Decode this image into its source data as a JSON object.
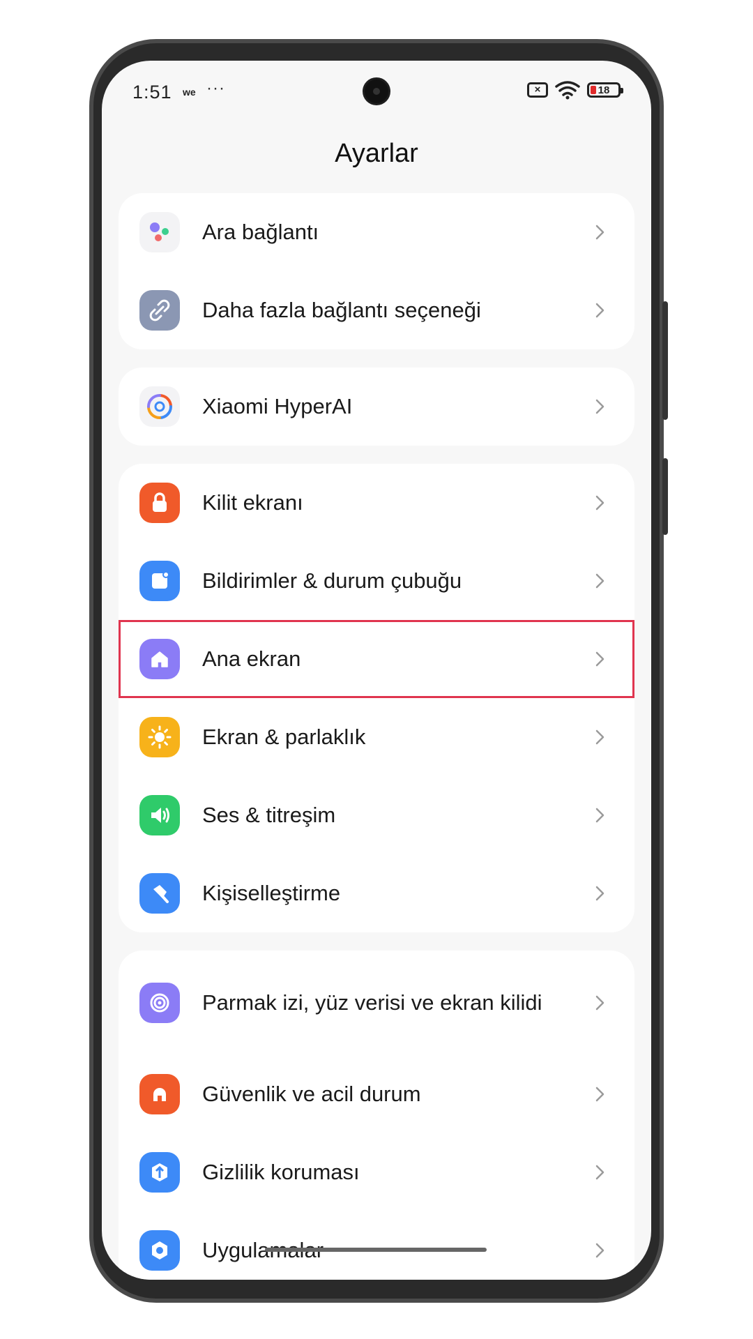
{
  "status": {
    "time": "1:51",
    "carrier": "we",
    "dots": "···",
    "sim": "×",
    "battery": "18"
  },
  "title": "Ayarlar",
  "groups": [
    {
      "items": [
        {
          "label": "Ara bağlantı",
          "icon": "dots-cluster-icon"
        },
        {
          "label": "Daha fazla bağlantı seçeneği",
          "icon": "link-icon",
          "color": "#8b97b3"
        }
      ]
    },
    {
      "items": [
        {
          "label": "Xiaomi HyperAI",
          "icon": "hyperai-swirl-icon"
        }
      ]
    },
    {
      "items": [
        {
          "label": "Kilit ekranı",
          "icon": "lock-icon",
          "color": "#f05a2a"
        },
        {
          "label": "Bildirimler & durum çubuğu",
          "icon": "notification-icon",
          "color": "#3d8af7"
        },
        {
          "label": "Ana ekran",
          "icon": "home-icon",
          "color": "#8b7cf6",
          "highlighted": true
        },
        {
          "label": "Ekran & parlaklık",
          "icon": "sun-icon",
          "color": "#f7b21a"
        },
        {
          "label": "Ses & titreşim",
          "icon": "speaker-icon",
          "color": "#2fcb6a"
        },
        {
          "label": "Kişiselleştirme",
          "icon": "brush-icon",
          "color": "#3d8af7"
        }
      ]
    },
    {
      "items": [
        {
          "label": "Parmak izi, yüz verisi ve ekran kilidi",
          "icon": "fingerprint-icon",
          "color": "#8b7cf6"
        },
        {
          "label": "Güvenlik ve acil durum",
          "icon": "alert-icon",
          "color": "#f05a2a"
        },
        {
          "label": "Gizlilik koruması",
          "icon": "privacy-icon",
          "color": "#3d8af7"
        },
        {
          "label": "Uygulamalar",
          "icon": "apps-icon",
          "color": "#3d8af7"
        }
      ]
    }
  ]
}
